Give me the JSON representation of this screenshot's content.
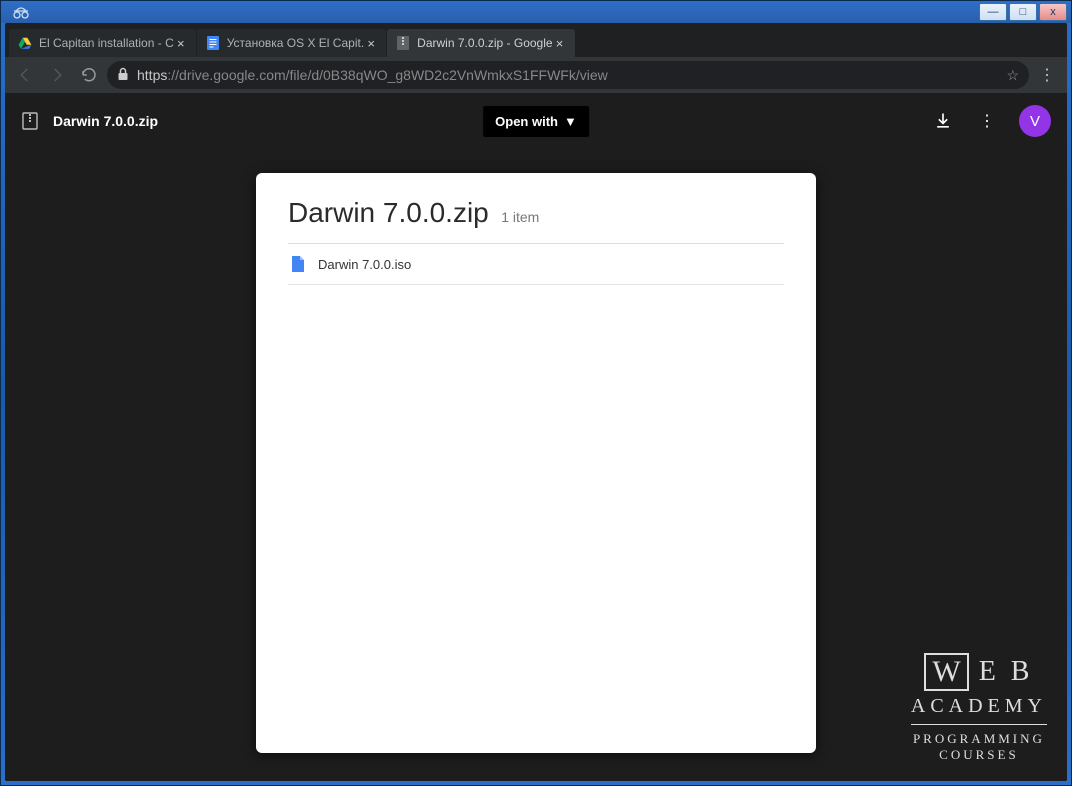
{
  "window": {
    "minimize": "—",
    "maximize": "□",
    "close": "x"
  },
  "tabs": [
    {
      "title": "El Capitan installation - C",
      "favicon": "drive"
    },
    {
      "title": "Установка OS X El Capit.",
      "favicon": "docs"
    },
    {
      "title": "Darwin 7.0.0.zip - Google",
      "favicon": "archive",
      "active": true
    }
  ],
  "omnibox": {
    "scheme": "https",
    "host": "://drive.google.com",
    "path": "/file/d/0B38qWO_g8WD2c2VnWmkxS1FFWFk/view"
  },
  "drive": {
    "filename": "Darwin 7.0.0.zip",
    "open_with": "Open with",
    "card_title": "Darwin 7.0.0.zip",
    "item_count": "1 item",
    "files": [
      {
        "name": "Darwin 7.0.0.iso"
      }
    ],
    "avatar_letter": "V"
  },
  "watermark": {
    "w": "W",
    "eb": "E B",
    "academy": "ACADEMY",
    "programming": "PROGRAMMING",
    "courses": "COURSES"
  }
}
